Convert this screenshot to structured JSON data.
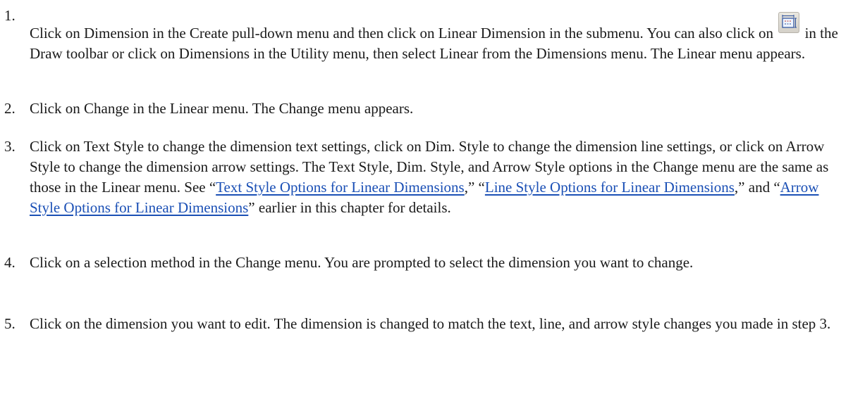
{
  "steps": [
    {
      "number": "1.",
      "parts": {
        "a": "Click on Dimension in the Create pull-down menu and then click on Linear Dimension in the submenu. You can also click on",
        "b": "in the Draw toolbar or click on Dimensions in the Utility menu, then select Linear from the Dimensions menu. The Linear menu appears."
      },
      "icon": "linear-dimension-icon"
    },
    {
      "number": "2.",
      "text": "Click on Change in the Linear menu. The Change menu appears."
    },
    {
      "number": "3.",
      "parts": {
        "a": "Click on Text Style to change the dimension text settings, click on Dim. Style to change the dimension line settings, or click on Arrow Style to change the dimension arrow settings. The Text Style, Dim. Style, and Arrow Style options in the Change menu are the same as those in the Linear menu. See “",
        "link1": "Text Style Options for Linear Dimensions",
        "b": ",” “",
        "link2": "Line Style Options for Linear Dimensions",
        "c": ",” and “",
        "link3": "Arrow Style Options for Linear Dimensions",
        "d": "” earlier in this chapter for details."
      },
      "link_color": "#1a4fb5"
    },
    {
      "number": "4.",
      "text": "Click on a selection method in the Change menu. You are prompted to select the dimension you want to change."
    },
    {
      "number": "5.",
      "text": "Click on the dimension you want to edit. The dimension is changed to match the text, line, and arrow style changes you made in step 3."
    }
  ]
}
